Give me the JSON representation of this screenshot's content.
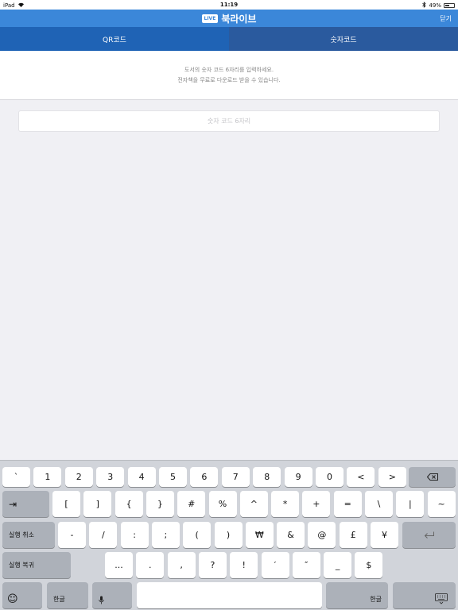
{
  "status_bar": {
    "device": "iPad",
    "time": "11:19",
    "battery": "49%",
    "battery_level": 0.49,
    "icons": [
      "wifi-icon",
      "bluetooth-icon",
      "battery-icon"
    ]
  },
  "nav": {
    "logo_badge": "LIVE",
    "app_name": "북라이브",
    "close": "닫기"
  },
  "tabs": [
    {
      "label": "QR코드",
      "active": false
    },
    {
      "label": "숫자코드",
      "active": true
    }
  ],
  "content": {
    "desc_line1": "도서의 숫자 코드 6자리를 입력하세요.",
    "desc_line2": "전자책을 무료로 다운로드 받을 수 있습니다.",
    "input_value": "",
    "input_placeholder": "숫자 코드 6자리"
  },
  "keyboard": {
    "row1": [
      "`",
      "1",
      "2",
      "3",
      "4",
      "5",
      "6",
      "7",
      "8",
      "9",
      "0",
      "<",
      ">"
    ],
    "row2_tab_symbol": "⇥",
    "row2": [
      "[",
      "]",
      "{",
      "}",
      "#",
      "%",
      "^",
      "*",
      "+",
      "=",
      "\\",
      "|",
      "~"
    ],
    "row3_left": "실행 취소",
    "row3": [
      "-",
      "/",
      ":",
      ";",
      "(",
      ")",
      "₩",
      "&",
      "@",
      "£",
      "¥"
    ],
    "row4_left": "실행 복귀",
    "row4": [
      "...",
      ".",
      ",",
      "?",
      "!",
      "′",
      "″",
      "_",
      "$"
    ],
    "emoji_symbol": "☺",
    "lang_left": "한글",
    "lang_right": "한글",
    "space": ""
  },
  "colors": {
    "nav_blue": "#3b87d9",
    "tab_blue": "#1f63b5",
    "keyboard_bg": "#d1d4da"
  }
}
